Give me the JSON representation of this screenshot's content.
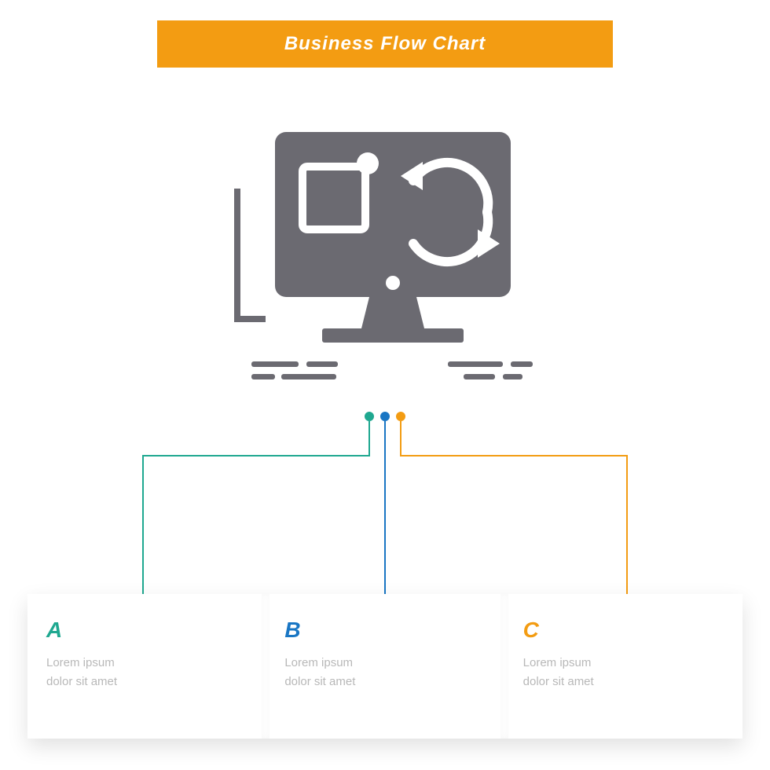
{
  "header": {
    "title": "Business Flow Chart"
  },
  "icon": {
    "name": "monitor-sync-icon",
    "color": "#6b6a71"
  },
  "connectors": {
    "colors": {
      "a": "#1fa890",
      "b": "#1976c4",
      "c": "#f39c12"
    }
  },
  "cards": [
    {
      "letter": "A",
      "body": "Lorem ipsum\ndolor sit amet"
    },
    {
      "letter": "B",
      "body": "Lorem ipsum\ndolor sit amet"
    },
    {
      "letter": "C",
      "body": "Lorem ipsum\ndolor sit amet"
    }
  ]
}
